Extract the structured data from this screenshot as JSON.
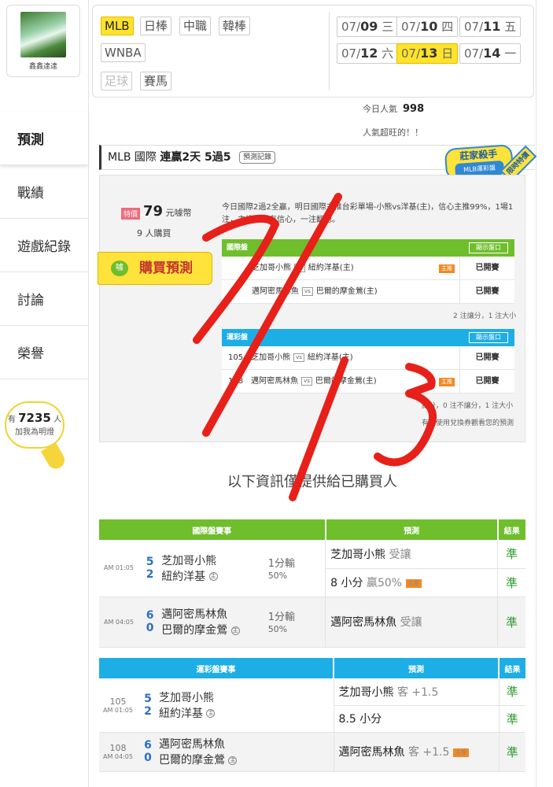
{
  "user": {
    "name": "鑫鑫達達",
    "fans_prefix": "有",
    "fans_count": "7235",
    "fans_unit": "人",
    "fans_cta": "加我為明燈"
  },
  "nav": [
    "預測",
    "戰績",
    "遊戲紀錄",
    "討論",
    "榮譽"
  ],
  "leagues": {
    "row1": [
      "MLB",
      "日棒",
      "中職",
      "韓棒"
    ],
    "row2": [
      "WNBA"
    ],
    "row3": [
      "足球",
      "賽馬"
    ]
  },
  "dates": [
    {
      "md": "07/",
      "d": "09",
      "wd": "三"
    },
    {
      "md": "07/",
      "d": "10",
      "wd": "四"
    },
    {
      "md": "07/",
      "d": "11",
      "wd": "五"
    },
    {
      "md": "07/",
      "d": "12",
      "wd": "六"
    },
    {
      "md": "07/",
      "d": "13",
      "wd": "日"
    },
    {
      "md": "07/",
      "d": "14",
      "wd": "一"
    }
  ],
  "popularity": {
    "label": "今日人氣",
    "value": "998",
    "comment": "人氣超旺的！！"
  },
  "title": {
    "league": "MLB 國際",
    "streak": "連贏2天 5過5",
    "record_btn": "預測記錄"
  },
  "stamp": {
    "main": "莊家殺手",
    "sub": "MLB運彩盤",
    "limit": "限時特價"
  },
  "price": {
    "special": "特價",
    "amount": "79",
    "unit": "元噱幣",
    "buyers": "9 人購買"
  },
  "buy_button": {
    "coin": "噱",
    "label": "購買預測"
  },
  "description": "今日國際2過2全贏，明日國際主推台彩單場-小熊vs洋基(主)，信心主推99%，1場1注，主推非常有信心，一注翻總。",
  "intl_mini": {
    "title": "國際盤",
    "show": "顯示盤口",
    "rows": [
      {
        "away": "芝加哥小熊",
        "vs": "vs",
        "home": "紐約洋基(主)",
        "badge": "主推",
        "status": "已開賽"
      },
      {
        "away": "邁阿密馬林魚",
        "vs": "vs",
        "home": "巴爾的摩金鶯(主)",
        "badge": "",
        "status": "已開賽"
      }
    ],
    "note": "2 注讓分，1 注大小"
  },
  "lottery_mini": {
    "title": "運彩盤",
    "show": "顯示盤口",
    "rows": [
      {
        "num": "105",
        "away": "芝加哥小熊",
        "vs": "vs",
        "home": "紐約洋基(主)",
        "badge": "",
        "status": "已開賽"
      },
      {
        "num": "108",
        "away": "邁阿密馬林魚",
        "vs": "vs",
        "home": "巴爾的摩金鶯(主)",
        "badge": "主推",
        "status": "已開賽"
      }
    ],
    "note": "讓分，0 注不讓分，1 注大小",
    "note2": "有人使用兌換券觀看您的預測"
  },
  "purchase_msg": "以下資訊僅提供給已購買人",
  "intl_table": {
    "head": [
      "國際盤賽事",
      "預測",
      "結果"
    ],
    "games": [
      {
        "time": "AM 01:05",
        "s1": "5",
        "s2": "2",
        "t1": "芝加哥小熊",
        "t2": "紐約洋基",
        "home": "主",
        "handi": "1分輸",
        "handi_pct": "50%",
        "preds": [
          {
            "text": "芝加哥小熊",
            "extra": "受讓",
            "badge": "",
            "res": "準"
          },
          {
            "text": "8 小分",
            "extra": "贏50%",
            "badge": "主推",
            "res": "準"
          }
        ]
      },
      {
        "time": "AM 04:05",
        "s1": "6",
        "s2": "0",
        "t1": "邁阿密馬林魚",
        "t2": "巴爾的摩金鶯",
        "home": "主",
        "handi": "1分輸",
        "handi_pct": "50%",
        "preds": [
          {
            "text": "邁阿密馬林魚",
            "extra": "受讓",
            "badge": "",
            "res": "準"
          }
        ]
      }
    ]
  },
  "lottery_table": {
    "head": [
      "運彩盤賽事",
      "預測",
      "結果"
    ],
    "games": [
      {
        "num": "105",
        "time": "AM 01:05",
        "s1": "5",
        "s2": "2",
        "t1": "芝加哥小熊",
        "t2": "紐約洋基",
        "home": "主",
        "preds": [
          {
            "text": "芝加哥小熊",
            "extra": "客 +1.5",
            "badge": "",
            "res": "準"
          },
          {
            "text": "8.5 小分",
            "extra": "",
            "badge": "",
            "res": "準"
          }
        ]
      },
      {
        "num": "108",
        "time": "AM 04:05",
        "s1": "6",
        "s2": "0",
        "t1": "邁阿密馬林魚",
        "t2": "巴爾的摩金鶯",
        "home": "主",
        "preds": [
          {
            "text": "邁阿密馬林魚",
            "extra": "客 +1.5",
            "badge": "主推",
            "res": "準"
          }
        ]
      }
    ]
  },
  "colors": {
    "green": "#6fbe2c",
    "blue": "#1eaee6",
    "yellow": "#ffe32a",
    "red_ink": "#e8201a"
  },
  "handwriting": "7/13"
}
